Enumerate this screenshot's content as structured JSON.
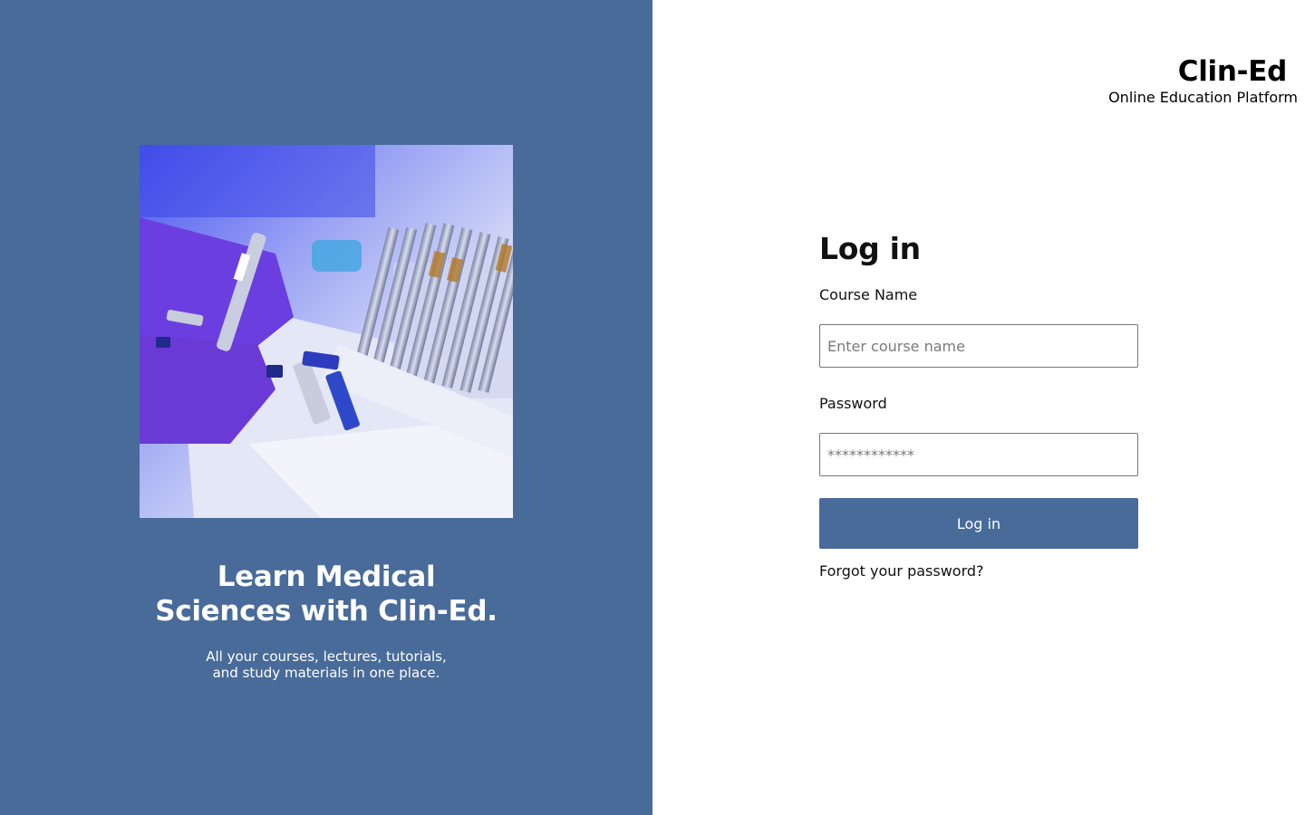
{
  "hero": {
    "title_line1": "Learn Medical",
    "title_line2": "Sciences with Clin-Ed.",
    "subtitle_line1": "All your courses, lectures, tutorials,",
    "subtitle_line2": "and study materials in one place.",
    "image_description": "photo-lab-gloved-hands-vials"
  },
  "brand": {
    "name": "Clin-Ed",
    "tagline": "Online Education Platform"
  },
  "login": {
    "heading": "Log in",
    "course_label": "Course Name",
    "course_placeholder": "Enter course name",
    "course_value": "",
    "password_label": "Password",
    "password_placeholder": "************",
    "button_label": "Log in",
    "forgot_label": "Forgot your password?"
  },
  "colors": {
    "accent": "#486b99",
    "background": "#ffffff",
    "text": "#111111"
  }
}
